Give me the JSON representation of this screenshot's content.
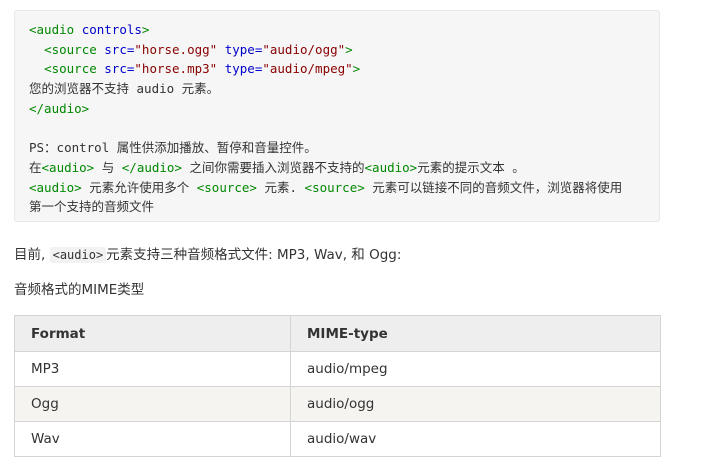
{
  "code": {
    "l1": {
      "tag_open": "<audio ",
      "attr": "controls",
      "tag_close": ">"
    },
    "l2": {
      "indent": "  ",
      "tag_open": "<source ",
      "attr_src": "src=",
      "val_src": "\"horse.ogg\"",
      "attr_type": "type=",
      "val_type": "\"audio/ogg\"",
      "tag_close": ">"
    },
    "l3": {
      "indent": "  ",
      "tag_open": "<source ",
      "attr_src": "src=",
      "val_src": "\"horse.mp3\"",
      "attr_type": "type=",
      "val_type": "\"audio/mpeg\"",
      "tag_close": ">"
    },
    "l4": "您的浏览器不支持 audio 元素。",
    "l5": "</audio>",
    "ps_line": "PS：control 属性供添加播放、暂停和音量控件。",
    "n1": {
      "pre": "在",
      "t1": "<audio>",
      "mid1": " 与 ",
      "t2": "</audio>",
      "mid2": " 之间你需要插入浏览器不支持的",
      "t3": "<audio>",
      "post": "元素的提示文本 。"
    },
    "n2": {
      "t1": "<audio>",
      "mid1": " 元素允许使用多个 ",
      "t2": "<source>",
      "mid2": " 元素. ",
      "t3": "<source>",
      "post": " 元素可以链接不同的音频文件，浏览器将使用"
    },
    "n3": "第一个支持的音频文件"
  },
  "intro": {
    "pre": "目前, ",
    "code": "<audio>",
    "post": "元素支持三种音频格式文件: MP3, Wav, 和 Ogg:"
  },
  "mime_heading": "音频格式的MIME类型",
  "table": {
    "headers": [
      "Format",
      "MIME-type"
    ],
    "rows": [
      [
        "MP3",
        "audio/mpeg"
      ],
      [
        "Ogg",
        "audio/ogg"
      ],
      [
        "Wav",
        "audio/wav"
      ]
    ]
  },
  "colors": {
    "tag": "#008800",
    "attr": "#0000cc",
    "string": "#880000"
  }
}
